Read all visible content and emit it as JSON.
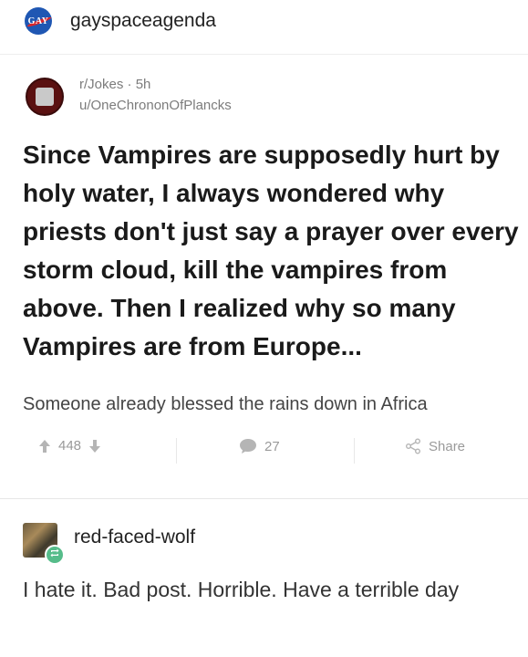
{
  "header": {
    "logo_text": "GAY",
    "blog_name": "gayspaceagenda"
  },
  "reddit_post": {
    "subreddit": "r/Jokes",
    "age": "5h",
    "meta_sep": "·",
    "username": "u/OneChrononOfPlancks",
    "title": "Since Vampires are supposedly hurt by holy water, I always wondered why priests don't just say a prayer over every storm cloud, kill the vampires from above. Then I realized why so many Vampires are from Europe...",
    "body": "Someone already blessed the rains down in Africa",
    "score": "448",
    "comments": "27",
    "share_label": "Share"
  },
  "reblog": {
    "username": "red-faced-wolf",
    "comment": "I hate it. Bad post. Horrible. Have a terrible day"
  },
  "colors": {
    "logo_blue": "#1f57b3",
    "reblog_green": "#56bc8a"
  }
}
